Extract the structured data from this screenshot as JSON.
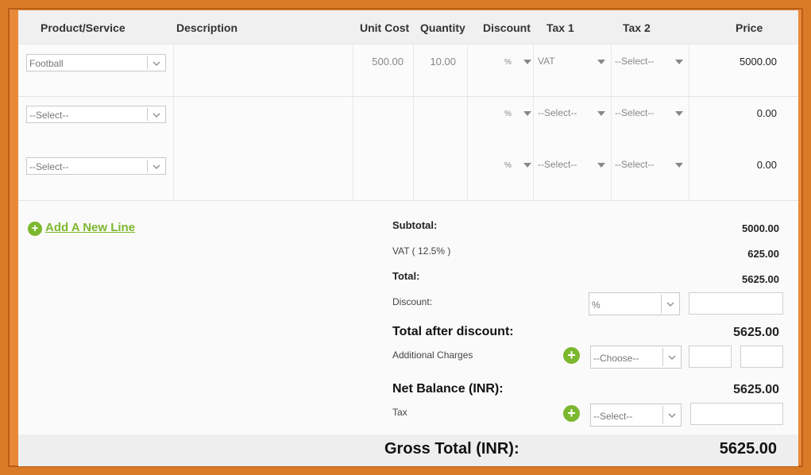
{
  "columns": [
    "Product/Service",
    "Description",
    "Unit Cost",
    "Quantity",
    "Discount",
    "Tax 1",
    "Tax 2",
    "Price"
  ],
  "rows": [
    {
      "product": "Football",
      "unit_cost": "500.00",
      "quantity": "10.00",
      "discount": "%",
      "tax1": "VAT",
      "tax2": "--Select--",
      "price": "5000.00"
    },
    {
      "product": "--Select--",
      "unit_cost": "",
      "quantity": "",
      "discount": "%",
      "tax1": "--Select--",
      "tax2": "--Select--",
      "price": "0.00"
    },
    {
      "product": "--Select--",
      "unit_cost": "",
      "quantity": "",
      "discount": "%",
      "tax1": "--Select--",
      "tax2": "--Select--",
      "price": "0.00"
    }
  ],
  "add_line": "Add A New Line",
  "summary": {
    "subtotal_label": "Subtotal:",
    "subtotal": "5000.00",
    "vat_label": "VAT ( 12.5% )",
    "vat": "625.00",
    "total_label": "Total:",
    "total": "5625.00",
    "discount_label": "Discount:",
    "discount_type": "%",
    "discount_value": "",
    "after_discount_label": "Total after discount:",
    "after_discount": "5625.00",
    "charges_label": "Additional Charges",
    "charges_select": "--Choose--",
    "net_label": "Net Balance (INR):",
    "net": "5625.00",
    "tax_label": "Tax",
    "tax_select": "--Select--",
    "gross_label": "Gross Total (INR):",
    "gross": "5625.00"
  },
  "colors": {
    "accent": "#7cb82f",
    "frame": "#e8893a"
  }
}
